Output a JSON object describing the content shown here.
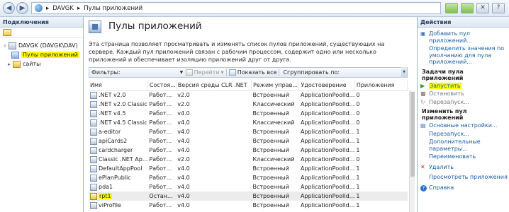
{
  "address_bar": {
    "segments": [
      "DAVGK",
      "Пулы приложений"
    ],
    "separator": "▸"
  },
  "left_panel": {
    "title": "Подключения",
    "tree": [
      {
        "label": "DAVGK (DAVGK\\DAV)",
        "expand": "▿"
      },
      {
        "label": "Пулы приложений",
        "selected": true
      },
      {
        "label": "сайты",
        "expand": "▸"
      }
    ]
  },
  "main": {
    "title": "Пулы приложений",
    "description": "Эта страница позволяет просматривать и изменять список пулов приложений, существующих на сервере. Каждый пул приложений связан с рабочим процессом, содержит одно или несколько приложений и обеспечивает изоляцию приложений друг от друга.",
    "filter_bar": {
      "filter_label": "Фильтры:",
      "go_label": "Перейти",
      "show_all_label": "Показать все",
      "group_by_label": "Сгруппировать по:"
    },
    "columns": [
      "Имя",
      "Состоя...",
      "Версия среды CLR .NET",
      "Режим управ...",
      "Удостоверение",
      "Приложения"
    ],
    "rows": [
      {
        "name": ".NET v2.0",
        "state": "Работ...",
        "clr": "v2.0",
        "mode": "Встроенный",
        "identity": "ApplicationPoolId...",
        "apps": "0"
      },
      {
        "name": ".NET v2.0 Classic",
        "state": "Работ...",
        "clr": "v2.0",
        "mode": "Классический",
        "identity": "ApplicationPoolId...",
        "apps": "0"
      },
      {
        "name": ".NET v4.5",
        "state": "Работ...",
        "clr": "v4.0",
        "mode": "Встроенный",
        "identity": "ApplicationPoolId...",
        "apps": "0"
      },
      {
        "name": ".NET v4.5 Classic",
        "state": "Работ...",
        "clr": "v4.0",
        "mode": "Классический",
        "identity": "ApplicationPoolId...",
        "apps": "0"
      },
      {
        "name": "a-editor",
        "state": "Работ...",
        "clr": "v4.0",
        "mode": "Встроенный",
        "identity": "ApplicationPoolId...",
        "apps": "1"
      },
      {
        "name": "apiCards2",
        "state": "Работ...",
        "clr": "v4.0",
        "mode": "Встроенный",
        "identity": "ApplicationPoolId...",
        "apps": "1"
      },
      {
        "name": "cardcharger",
        "state": "Работ...",
        "clr": "v4.0",
        "mode": "Встроенный",
        "identity": "ApplicationPoolId...",
        "apps": "1"
      },
      {
        "name": "Classic .NET Ap...",
        "state": "Работ...",
        "clr": "v2.0",
        "mode": "Классический",
        "identity": "ApplicationPoolId...",
        "apps": "0"
      },
      {
        "name": "DefaultAppPool",
        "state": "Работ...",
        "clr": "v4.0",
        "mode": "Встроенный",
        "identity": "ApplicationPoolId...",
        "apps": "1"
      },
      {
        "name": "ePlanPublic",
        "state": "Работ...",
        "clr": "v4.0",
        "mode": "Встроенный",
        "identity": "ApplicationPoolId...",
        "apps": "1"
      },
      {
        "name": "pda1",
        "state": "Работ...",
        "clr": "v4.0",
        "mode": "Встроенный",
        "identity": "ApplicationPoolId...",
        "apps": "1"
      },
      {
        "name": "rpt1",
        "state": "Остан...",
        "clr": "v4.0",
        "mode": "Встроенный",
        "identity": "ApplicationPoolId...",
        "apps": "1",
        "selected": true
      },
      {
        "name": "viProfile",
        "state": "Работ...",
        "clr": "v4.0",
        "mode": "Встроенный",
        "identity": "ApplicationPoolId...",
        "apps": "1"
      }
    ]
  },
  "actions": {
    "title": "Действия",
    "add_pool": "Добавить пул приложений...",
    "set_defaults": "Определить значения по умолчанию для пула приложений...",
    "section_tasks": "Задачи пула приложений",
    "start": "Запустить",
    "stop": "Остановить",
    "restart": "Перезапуск...",
    "section_edit": "Изменить пул приложений",
    "basic_settings": "Основные настройки...",
    "recycle": "Перезапуск...",
    "advanced_settings": "Дополнительные параметры...",
    "rename": "Переименовать",
    "remove": "Удалить",
    "view_apps": "Просмотреть приложения",
    "help": "Справка"
  },
  "colors": {
    "highlight": "#ffff00",
    "link": "#1a5ea7",
    "header_gradient_top": "#f2f6fb",
    "header_gradient_bottom": "#dce6f2"
  }
}
